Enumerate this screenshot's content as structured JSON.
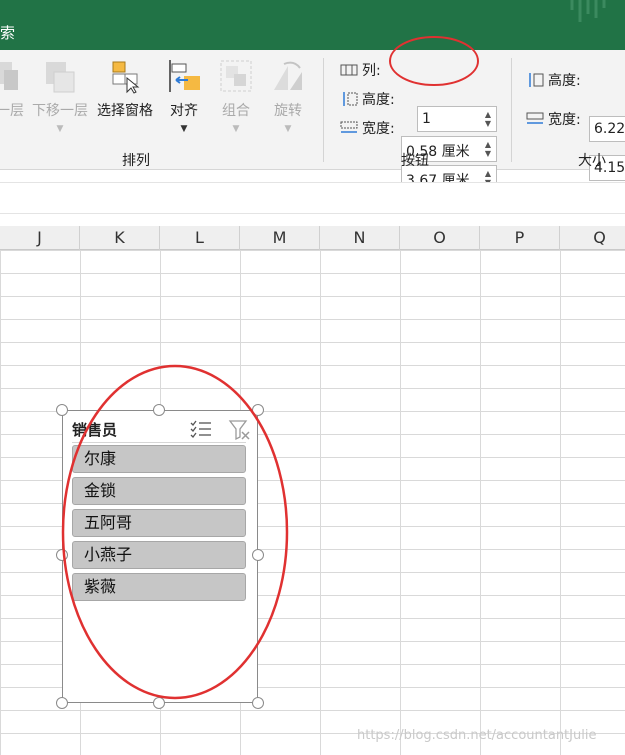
{
  "titlebar": {
    "partial_title": "索"
  },
  "ribbon": {
    "arrange": {
      "partial_button": "一层",
      "send_backward": "下移一层",
      "selection_pane": "选择窗格",
      "align": "对齐",
      "group": "组合",
      "rotate": "旋转",
      "group_label": "排列"
    },
    "buttons": {
      "columns_label": "列:",
      "columns_value": "1",
      "height_label": "高度:",
      "height_value": "0.58 厘米",
      "width_label": "宽度:",
      "width_value": "3.67 厘米",
      "group_label": "按钮"
    },
    "size": {
      "height_label": "高度:",
      "height_value": "6.22",
      "width_label": "宽度:",
      "width_value": "4.15",
      "group_label": "大小"
    }
  },
  "columns": [
    "J",
    "K",
    "L",
    "M",
    "N",
    "O",
    "P",
    "Q"
  ],
  "slicer": {
    "title": "销售员",
    "items": [
      "尔康",
      "金锁",
      "五阿哥",
      "小燕子",
      "紫薇"
    ]
  },
  "watermark": "https://blog.csdn.net/accountantJulie",
  "colors": {
    "title_bar": "#217346",
    "slicer_item_bg": "#c6c6c6",
    "annotation_red": "#e03131"
  }
}
